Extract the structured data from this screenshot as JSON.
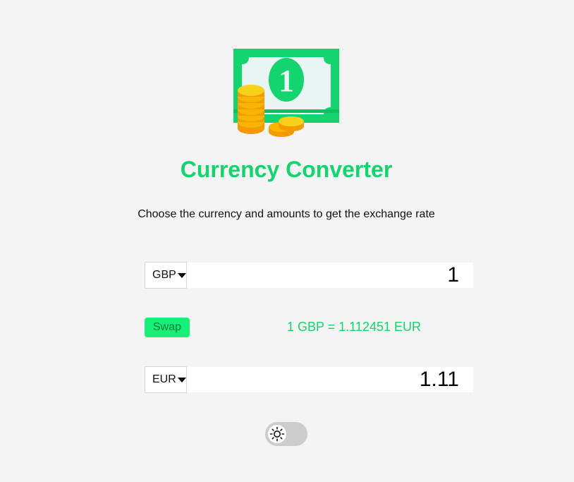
{
  "header": {
    "logo_icon": "money-bill-with-coins-icon",
    "logo_digit": "1",
    "title": "Currency Converter",
    "subtitle": "Choose the currency and amounts to get the exchange rate"
  },
  "converter": {
    "from": {
      "currency": "GBP",
      "amount": "1"
    },
    "swap_label": "Swap",
    "rate_text": "1 GBP = 1.112451 EUR",
    "to": {
      "currency": "EUR",
      "amount": "1.11"
    }
  },
  "theme_toggle": {
    "icon": "sun-icon",
    "state": "light"
  },
  "colors": {
    "accent": "#13d46e",
    "swap_button": "#16f077",
    "background": "#f4f4f4"
  }
}
